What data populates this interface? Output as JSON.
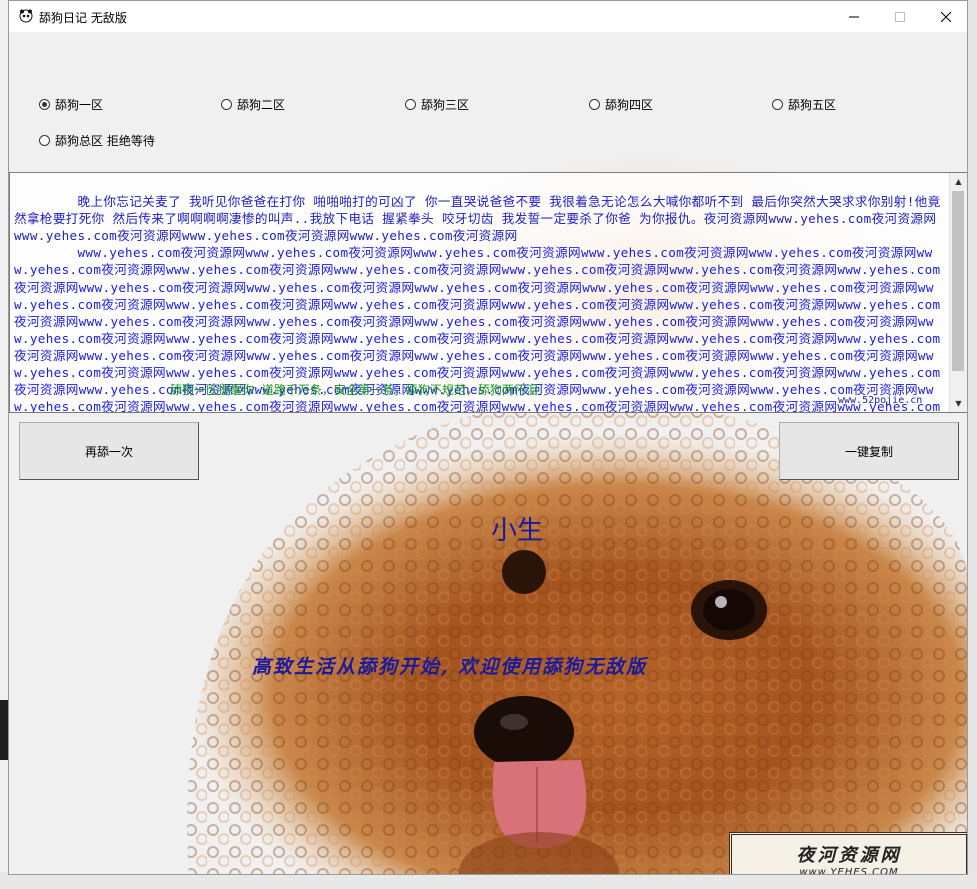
{
  "window": {
    "title": "舔狗日记 无敌版"
  },
  "radios": [
    {
      "label": "舔狗一区",
      "checked": true
    },
    {
      "label": "舔狗二区",
      "checked": false
    },
    {
      "label": "舔狗三区",
      "checked": false
    },
    {
      "label": "舔狗四区",
      "checked": false
    },
    {
      "label": "舔狗五区",
      "checked": false
    },
    {
      "label": "舔狗总区 拒绝等待",
      "checked": false
    }
  ],
  "textarea": {
    "first_line": "晚上你忘记关麦了 我听见你爸爸在打你 啪啪啪打的可凶了 你一直哭说爸爸不要 我很着急无论怎么大喊你都听不到 最后你突然大哭求求你别射!他竟然拿枪要打死你 然后传来了啊啊啊啊凄惨的叫声..我放下电话 握紧拳头 咬牙切齿 我发誓一定要杀了你爸 为你报仇。夜河资源网www.yehes.com夜河资源网www.yehes.com夜河资源网www.yehes.com夜河资源网www.yehes.com夜河资源网",
    "repeat_unit": "www.yehes.com夜河资源网",
    "overlay_text": "舔狗一区提醒你: 道路千万条，安全第一条，舔狗不规范，舔狗两行泪",
    "site_mark": "www.52pojie.cn"
  },
  "buttons": {
    "again": "再舔一次",
    "copy": "一键复制"
  },
  "nickname": "小生",
  "slogan": "高致生活从舔狗开始, 欢迎使用舔狗无敌版",
  "watermark": {
    "title": "夜河资源网",
    "url": "www.YEHES.COM"
  },
  "colors": {
    "text_blue": "#1c1ce0",
    "overlay_green": "#1a9a1a",
    "art_blue": "#1a1a9a"
  }
}
